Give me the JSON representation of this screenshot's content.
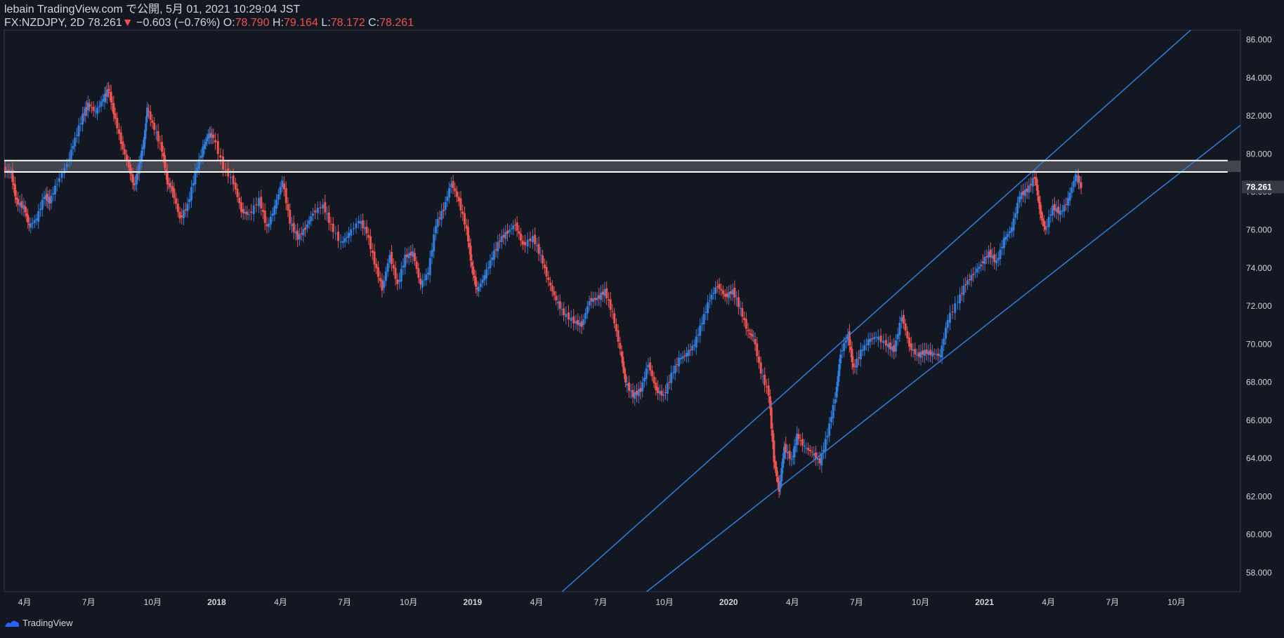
{
  "header": {
    "line1": "lebain TradingView.com で公開, 5月 01, 2021 10:29:04 JST",
    "symbol": "FX:NZDJPY, 2D",
    "last": "78.261",
    "arrow": "▼",
    "change": "−0.603 (−0.76%)",
    "o_label": "O:",
    "o_val": "78.790",
    "h_label": "H:",
    "h_val": "79.164",
    "l_label": "L:",
    "l_val": "78.172",
    "c_label": "C:",
    "c_val": "78.261"
  },
  "footer": {
    "brand": "TradingView"
  },
  "colors": {
    "bg": "#131722",
    "up": "#2f7fe0",
    "down": "#ef5350",
    "channel": "#2f7fe0",
    "zone": "#ffffff",
    "grid_text": "#d1d4dc"
  },
  "chart_data": {
    "type": "line",
    "title": "FX:NZDJPY, 2D",
    "xlabel": "",
    "ylabel": "",
    "ylim": [
      57,
      86.5
    ],
    "y_ticks": [
      "58.000",
      "60.000",
      "62.000",
      "64.000",
      "66.000",
      "68.000",
      "70.000",
      "72.000",
      "74.000",
      "76.000",
      "78.000",
      "80.000",
      "82.000",
      "84.000",
      "86.000"
    ],
    "x_ticks": [
      {
        "label": "4月",
        "t": 2017.25
      },
      {
        "label": "7月",
        "t": 2017.5
      },
      {
        "label": "10月",
        "t": 2017.75
      },
      {
        "label": "2018",
        "t": 2018.0
      },
      {
        "label": "4月",
        "t": 2018.25
      },
      {
        "label": "7月",
        "t": 2018.5
      },
      {
        "label": "10月",
        "t": 2018.75
      },
      {
        "label": "2019",
        "t": 2019.0
      },
      {
        "label": "4月",
        "t": 2019.25
      },
      {
        "label": "7月",
        "t": 2019.5
      },
      {
        "label": "10月",
        "t": 2019.75
      },
      {
        "label": "2020",
        "t": 2020.0
      },
      {
        "label": "4月",
        "t": 2020.25
      },
      {
        "label": "7月",
        "t": 2020.5
      },
      {
        "label": "10月",
        "t": 2020.75
      },
      {
        "label": "2021",
        "t": 2021.0
      },
      {
        "label": "4月",
        "t": 2021.25
      },
      {
        "label": "7月",
        "t": 2021.5
      },
      {
        "label": "10月",
        "t": 2021.75
      }
    ],
    "x_range": [
      2017.17,
      2022.0
    ],
    "last_price": "78.261",
    "series": [
      {
        "values": [
          [
            2017.17,
            79.2
          ],
          [
            2017.2,
            79.0
          ],
          [
            2017.22,
            77.5
          ],
          [
            2017.25,
            77.2
          ],
          [
            2017.27,
            76.2
          ],
          [
            2017.3,
            76.6
          ],
          [
            2017.33,
            77.8
          ],
          [
            2017.35,
            77.5
          ],
          [
            2017.38,
            78.5
          ],
          [
            2017.42,
            79.5
          ],
          [
            2017.45,
            80.8
          ],
          [
            2017.48,
            82.0
          ],
          [
            2017.5,
            82.6
          ],
          [
            2017.53,
            82.2
          ],
          [
            2017.56,
            82.9
          ],
          [
            2017.58,
            83.4
          ],
          [
            2017.6,
            82.2
          ],
          [
            2017.63,
            80.6
          ],
          [
            2017.66,
            79.3
          ],
          [
            2017.68,
            78.3
          ],
          [
            2017.7,
            79.4
          ],
          [
            2017.72,
            80.8
          ],
          [
            2017.73,
            82.4
          ],
          [
            2017.76,
            81.3
          ],
          [
            2017.79,
            80.2
          ],
          [
            2017.81,
            78.5
          ],
          [
            2017.83,
            78.1
          ],
          [
            2017.86,
            76.6
          ],
          [
            2017.89,
            77.3
          ],
          [
            2017.92,
            79.0
          ],
          [
            2017.95,
            80.3
          ],
          [
            2017.97,
            81.0
          ],
          [
            2017.99,
            80.9
          ],
          [
            2018.03,
            79.3
          ],
          [
            2018.07,
            78.5
          ],
          [
            2018.1,
            77.0
          ],
          [
            2018.13,
            76.8
          ],
          [
            2018.17,
            77.6
          ],
          [
            2018.2,
            76.1
          ],
          [
            2018.23,
            77.2
          ],
          [
            2018.26,
            78.6
          ],
          [
            2018.29,
            76.4
          ],
          [
            2018.32,
            75.6
          ],
          [
            2018.35,
            76.1
          ],
          [
            2018.38,
            76.9
          ],
          [
            2018.42,
            77.3
          ],
          [
            2018.45,
            76.2
          ],
          [
            2018.49,
            75.3
          ],
          [
            2018.52,
            75.8
          ],
          [
            2018.56,
            76.5
          ],
          [
            2018.59,
            75.9
          ],
          [
            2018.62,
            74.3
          ],
          [
            2018.65,
            72.9
          ],
          [
            2018.68,
            74.7
          ],
          [
            2018.71,
            73.1
          ],
          [
            2018.74,
            74.6
          ],
          [
            2018.77,
            74.8
          ],
          [
            2018.8,
            73.1
          ],
          [
            2018.83,
            73.8
          ],
          [
            2018.86,
            76.3
          ],
          [
            2018.89,
            77.1
          ],
          [
            2018.92,
            78.5
          ],
          [
            2018.95,
            77.5
          ],
          [
            2018.98,
            76.0
          ],
          [
            2019.0,
            74.0
          ],
          [
            2019.02,
            72.8
          ],
          [
            2019.05,
            73.6
          ],
          [
            2019.08,
            74.6
          ],
          [
            2019.11,
            75.5
          ],
          [
            2019.14,
            75.9
          ],
          [
            2019.17,
            76.3
          ],
          [
            2019.2,
            75.2
          ],
          [
            2019.24,
            75.6
          ],
          [
            2019.27,
            74.6
          ],
          [
            2019.3,
            73.3
          ],
          [
            2019.33,
            72.3
          ],
          [
            2019.36,
            71.6
          ],
          [
            2019.4,
            71.2
          ],
          [
            2019.43,
            71.0
          ],
          [
            2019.46,
            72.3
          ],
          [
            2019.49,
            72.4
          ],
          [
            2019.52,
            72.8
          ],
          [
            2019.55,
            71.6
          ],
          [
            2019.58,
            69.7
          ],
          [
            2019.6,
            68.0
          ],
          [
            2019.63,
            67.3
          ],
          [
            2019.66,
            67.6
          ],
          [
            2019.69,
            69.0
          ],
          [
            2019.72,
            67.6
          ],
          [
            2019.75,
            67.3
          ],
          [
            2019.78,
            68.4
          ],
          [
            2019.81,
            69.2
          ],
          [
            2019.84,
            69.5
          ],
          [
            2019.87,
            70.0
          ],
          [
            2019.9,
            71.2
          ],
          [
            2019.93,
            72.4
          ],
          [
            2019.96,
            73.1
          ],
          [
            2019.99,
            72.5
          ],
          [
            2020.02,
            72.8
          ],
          [
            2020.05,
            71.8
          ],
          [
            2020.08,
            70.6
          ],
          [
            2020.1,
            70.4
          ],
          [
            2020.13,
            68.5
          ],
          [
            2020.16,
            67.4
          ],
          [
            2020.18,
            63.9
          ],
          [
            2020.2,
            62.3
          ],
          [
            2020.22,
            64.6
          ],
          [
            2020.25,
            63.9
          ],
          [
            2020.27,
            65.2
          ],
          [
            2020.3,
            64.6
          ],
          [
            2020.33,
            64.3
          ],
          [
            2020.36,
            63.8
          ],
          [
            2020.39,
            65.3
          ],
          [
            2020.42,
            67.2
          ],
          [
            2020.44,
            69.5
          ],
          [
            2020.47,
            70.5
          ],
          [
            2020.49,
            68.7
          ],
          [
            2020.52,
            69.6
          ],
          [
            2020.55,
            70.2
          ],
          [
            2020.58,
            70.4
          ],
          [
            2020.62,
            70.0
          ],
          [
            2020.65,
            69.7
          ],
          [
            2020.68,
            71.5
          ],
          [
            2020.71,
            69.9
          ],
          [
            2020.74,
            69.4
          ],
          [
            2020.77,
            69.6
          ],
          [
            2020.8,
            69.5
          ],
          [
            2020.83,
            69.4
          ],
          [
            2020.86,
            71.3
          ],
          [
            2020.9,
            72.3
          ],
          [
            2020.93,
            73.2
          ],
          [
            2020.96,
            73.7
          ],
          [
            2020.99,
            74.2
          ],
          [
            2021.02,
            74.8
          ],
          [
            2021.05,
            74.3
          ],
          [
            2021.08,
            75.5
          ],
          [
            2021.11,
            76.1
          ],
          [
            2021.14,
            77.8
          ],
          [
            2021.17,
            78.1
          ],
          [
            2021.2,
            78.8
          ],
          [
            2021.22,
            76.9
          ],
          [
            2021.24,
            76.0
          ],
          [
            2021.27,
            77.2
          ],
          [
            2021.3,
            76.9
          ],
          [
            2021.33,
            77.6
          ],
          [
            2021.36,
            78.9
          ],
          [
            2021.38,
            78.26
          ]
        ]
      }
    ],
    "lines": [
      {
        "name": "",
        "x": [
          2019.35,
          2021.83
        ],
        "y": [
          57.0,
          86.8
        ]
      },
      {
        "name": "",
        "x": [
          2019.68,
          2022.0
        ],
        "y": [
          57.0,
          81.5
        ]
      },
      {
        "name": "",
        "x": [
          2017.17,
          2021.95
        ],
        "y": [
          79.65,
          79.65
        ]
      },
      {
        "name": "",
        "x": [
          2017.17,
          2021.95
        ],
        "y": [
          79.05,
          79.05
        ]
      }
    ]
  }
}
